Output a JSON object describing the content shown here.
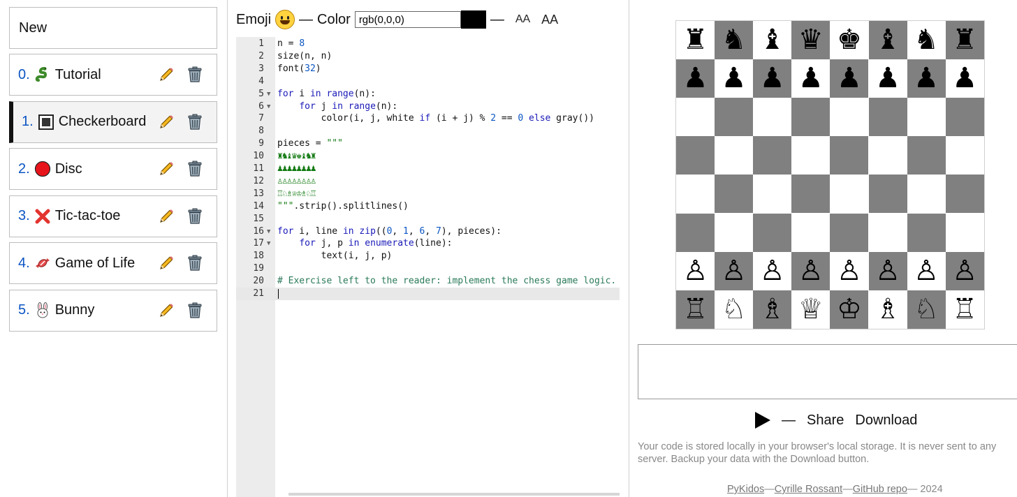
{
  "sidebar": {
    "new_label": "New",
    "programs": [
      {
        "num": "0.",
        "name": "Tutorial",
        "icon": "snake-icon"
      },
      {
        "num": "1.",
        "name": "Checkerboard",
        "icon": "square-icon"
      },
      {
        "num": "2.",
        "name": "Disc",
        "icon": "red-disc-icon"
      },
      {
        "num": "3.",
        "name": "Tic-tac-toe",
        "icon": "cross-icon"
      },
      {
        "num": "4.",
        "name": "Game of Life",
        "icon": "candy-icon"
      },
      {
        "num": "5.",
        "name": "Bunny",
        "icon": "rabbit-icon"
      }
    ],
    "selected_index": 1
  },
  "toolbar": {
    "emoji_label": "Emoji",
    "dash1": "—",
    "color_label": "Color",
    "color_value": "rgb(0,0,0)",
    "dash2": "—",
    "font_small_label": "AA",
    "font_big_label": "AA"
  },
  "code": {
    "lines": [
      "n = 8",
      "size(n, n)",
      "font(32)",
      "",
      "for i in range(n):",
      "    for j in range(n):",
      "        color(i, j, white if (i + j) % 2 == 0 else gray())",
      "",
      "pieces = \"\"\"",
      "♜♞♝♛♚♝♞♜",
      "♟♟♟♟♟♟♟♟",
      "♙♙♙♙♙♙♙♙",
      "♖♘♗♕♔♗♘♖",
      "\"\"\".strip().splitlines()",
      "",
      "for i, line in zip((0, 1, 6, 7), pieces):",
      "    for j, p in enumerate(line):",
      "        text(i, j, p)",
      "",
      "# Exercise left to the reader: implement the chess game logic.",
      ""
    ],
    "fold_lines": [
      5,
      6,
      16,
      17
    ],
    "active_line": 21
  },
  "board": {
    "size": 8,
    "light_color": "#ffffff",
    "dark_color": "#808080",
    "rows": [
      "♜♞♝♛♚♝♞♜",
      "♟♟♟♟♟♟♟♟",
      "        ",
      "        ",
      "        ",
      "        ",
      "♙♙♙♙♙♙♙♙",
      "♖♘♗♕♔♗♘♖"
    ]
  },
  "controls": {
    "dash": "—",
    "share_label": "Share",
    "download_label": "Download"
  },
  "notice": "Your code is stored locally in your browser's local storage. It is never sent to any server. Backup your data with the Download button.",
  "footer": {
    "pykidos": "PyKidos",
    "sep1": "—",
    "author": "Cyrille Rossant",
    "sep2": "—",
    "repo": "GitHub repo",
    "year": "— 2024"
  }
}
